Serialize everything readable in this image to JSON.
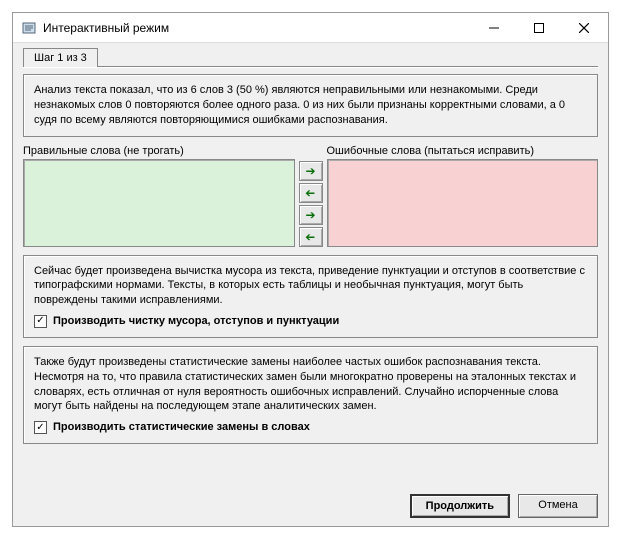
{
  "window": {
    "title": "Интерактивный режим"
  },
  "tab": {
    "label": "Шаг 1 из 3"
  },
  "analysis": {
    "text": "Анализ текста показал, что из 6 слов 3 (50 %) являются неправильными или незнакомыми. Среди незнакомых слов 0 повторяются более одного раза. 0 из них были признаны корректными словами, а 0 судя по всему являются повторяющимися ошибками распознавания."
  },
  "lists": {
    "left_label": "Правильные слова (не трогать)",
    "right_label": "Ошибочные слова (пытаться исправить)"
  },
  "cleanup": {
    "text": "Сейчас будет произведена вычистка мусора из текста, приведение пунктуации и отступов в соответствие с типографскими нормами. Тексты, в которых есть таблицы и необычная пунктуация, могут быть повреждены такими исправлениями.",
    "checkbox_label": "Производить чистку мусора, отступов и пунктуации",
    "checked": true
  },
  "stats": {
    "text": "Также будут произведены статистические замены наиболее частых ошибок распознавания текста. Несмотря на то, что правила статистических замен были многократно проверены на эталонных текстах и словарях, есть отличная от нуля вероятность ошибочных исправлений. Случайно испорченные слова могут быть найдены на последующем этапе аналитических замен.",
    "checkbox_label": "Производить статистические замены в словах",
    "checked": true
  },
  "footer": {
    "continue": "Продолжить",
    "cancel": "Отмена"
  }
}
